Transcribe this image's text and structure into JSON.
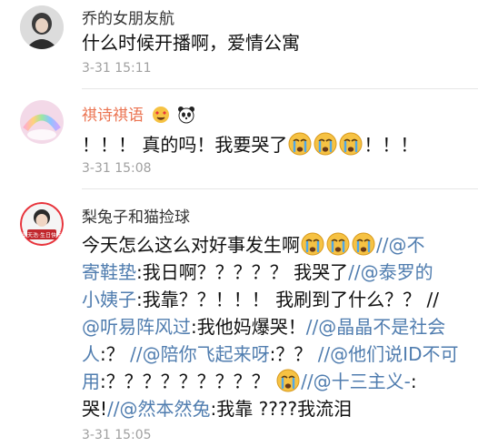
{
  "comments": [
    {
      "name": "乔的女朋友航",
      "text": "什么时候开播啊，爱情公寓",
      "time": "3-31 15:11"
    },
    {
      "name": "祺诗祺语",
      "badges": [
        "heart-eyes-emoji",
        "panda-emoji"
      ],
      "text_prefix": "！！！ 真的吗！我要哭了",
      "text_suffix": "！！！",
      "emoji": "crying-face",
      "time": "3-31 15:08"
    },
    {
      "name": "梨兔子和猫捡球",
      "avatar_caption": "李天浩·生日快乐",
      "lines": {
        "l1_text": "今天怎么这么对好事发生啊",
        "l1_link": "//@不",
        "l2_link": "寄鞋垫",
        "l2_text": ":我日啊？？？？？ 我哭了",
        "l2_link2": "//@泰罗的",
        "l3_link": "小姨子",
        "l3_text": ":我靠？？！！！ 我刷到了什么？？ //",
        "l4_link": "@听易阵风过",
        "l4_text": ":我他妈爆哭！",
        "l4_link2": "//@晶晶不是社会",
        "l5_link": "人",
        "l5_text": ":？ ",
        "l5_link2": "//@陪你飞起来呀",
        "l5_text2": ":？？ ",
        "l5_link3": "//@他们说ID不可",
        "l6_link": "用",
        "l6_text": ":？？？？？？？？？ ",
        "l6_link2": "//@十三主义-",
        "l6_text2": ":",
        "l7_text": "哭!",
        "l7_link": "//@然本然兔",
        "l7_text2": ":我靠 ????我流泪"
      },
      "time": "3-31 15:05"
    }
  ],
  "colors": {
    "link": "#507daf",
    "name_highlight": "#eb7350",
    "time": "#a0a0a0"
  }
}
